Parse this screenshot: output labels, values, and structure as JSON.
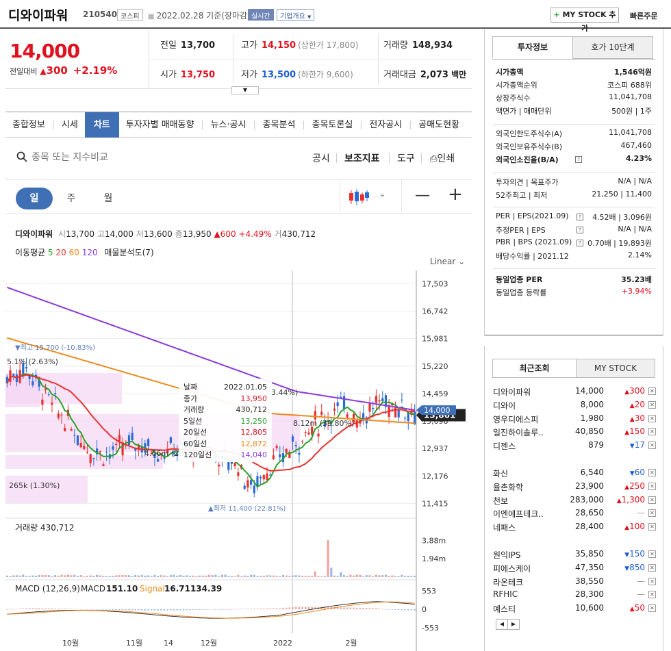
{
  "header": {
    "stock_name": "디와이파워",
    "stock_code": "210540",
    "market_badge": "코스피",
    "date_text": "2022.02.28 기준(장마감)",
    "realtime_badge": "실시간",
    "overview_btn": "기업개요",
    "mystock_btn": "MY STOCK 추가",
    "quick_order": "빠른주문"
  },
  "price": {
    "current": "14,000",
    "change_label": "전일대비",
    "change": "300",
    "change_pct": "+2.19%",
    "prev_label": "전일",
    "prev": "13,700",
    "high_label": "고가",
    "high": "14,150",
    "upper_limit": "(상한가 17,800)",
    "volume_label": "거래량",
    "volume": "148,934",
    "open_label": "시가",
    "open": "13,750",
    "low_label": "저가",
    "low": "13,500",
    "lower_limit": "(하한가 9,600)",
    "value_label": "거래대금",
    "value": "2,073",
    "value_unit": "백만"
  },
  "tabs": [
    "종합정보",
    "시세",
    "차트",
    "투자자별 매매동향",
    "뉴스·공시",
    "종목분석",
    "종목토론실",
    "전자공시",
    "공매도현황"
  ],
  "active_tab": 2,
  "search": {
    "placeholder": "종목 또는 지수비교"
  },
  "tools": {
    "disclosure": "공시",
    "indicator": "보조지표",
    "tools": "도구",
    "print": "인쇄"
  },
  "periods": [
    "일",
    "주",
    "월"
  ],
  "active_period": 0,
  "ohlc": {
    "name": "디와이파워",
    "open_label": "시",
    "open": "13,700",
    "high_label": "고",
    "high": "14,000",
    "low_label": "저",
    "low": "13,600",
    "close_label": "종",
    "close": "13,950",
    "change": "▲600",
    "change_pct": "+4.49%",
    "vol_label": "거",
    "vol": "430,712"
  },
  "ma_legend": {
    "label": "이동평균",
    "p5": "5",
    "p20": "20",
    "p60": "60",
    "p120": "120",
    "analysis": "매물분석도(7)"
  },
  "scale": "Linear",
  "chart_data": {
    "type": "line",
    "price_axis": [
      "17,503",
      "16,742",
      "15,981",
      "15,220",
      "14,459",
      "13,698",
      "12,937",
      "12,176",
      "11,415"
    ],
    "price_ylim": [
      11046,
      17870
    ],
    "x_labels": [
      "10월",
      "11월",
      "14",
      "12월",
      "2022",
      "2월"
    ],
    "current_price_tag": "13,861",
    "current_tag_partial": "14,000",
    "high_marker": "▼최고 15,700 (-10.83%)",
    "low_marker": "▲최저 11,400 (22.81%)",
    "profile_labels": [
      "5.1% (2.63%)",
      "3.44%)",
      "8.12m (39.80%)",
      "4.66m (22",
      "265k (1.30%)"
    ],
    "volume_title": "거래량 430,712",
    "volume_axis": [
      "3.88m",
      "1.94m"
    ],
    "macd_title": "MACD (12,26,9)",
    "macd_label": "MACD",
    "macd_value": "151.10",
    "signal_label": "Signal",
    "signal_value": "16.71134.39",
    "macd_axis": [
      "553",
      "0",
      "-553"
    ],
    "tooltip": {
      "date_label": "날짜",
      "date": "2022.01.05",
      "close_label": "종가",
      "close": "13,950",
      "vol_label": "거래량",
      "vol": "430,712",
      "ma5_label": "5일선",
      "ma5": "13,250",
      "ma20_label": "20일선",
      "ma20": "12,805",
      "ma60_label": "60일선",
      "ma60": "12,872",
      "ma120_label": "120일선",
      "ma120": "14,040"
    },
    "colors": {
      "ma5": "#2aa02a",
      "ma20": "#e8302f",
      "ma60": "#f08a1c",
      "ma120": "#8a3bdc",
      "up": "#e8302f",
      "down": "#2a6bd6"
    }
  },
  "info_panel": {
    "tab_invest": "투자정보",
    "tab_hoga": "호가 10단계",
    "rows1": [
      {
        "l": "시가총액",
        "r": "1,546억원",
        "bold": true
      },
      {
        "l": "시가총액순위",
        "r": "코스피 688위"
      },
      {
        "l": "상장주식수",
        "r": "11,041,708"
      },
      {
        "l": "액면가 | 매매단위",
        "r": "500원 | 1주"
      }
    ],
    "rows2": [
      {
        "l": "외국인한도주식수(A)",
        "r": "11,041,708"
      },
      {
        "l": "외국인보유주식수(B)",
        "r": "467,460"
      },
      {
        "l": "외국인소진율(B/A)",
        "r": "4.23%",
        "bold": true
      }
    ],
    "rows3": [
      {
        "l": "투자의견 | 목표주가",
        "r": "N/A | N/A"
      },
      {
        "l": "52주최고 | 최저",
        "r": "21,250 | 11,400"
      }
    ],
    "rows4": [
      {
        "l": "PER | EPS(2021.09)",
        "m": "4.52배 | 3,096원"
      },
      {
        "l": "추정PER | EPS",
        "m": "N/A | N/A"
      },
      {
        "l": "PBR | BPS (2021.09)",
        "m": "0.70배 | 19,893원"
      },
      {
        "l": "배당수익률 | 2021.12",
        "m": "2.14%"
      }
    ],
    "rows5": [
      {
        "l": "동일업종 PER",
        "r": "35.23배",
        "bold": true
      },
      {
        "l": "동일업종 등락률",
        "r": "+3.94%",
        "red": true
      }
    ]
  },
  "recent_panel": {
    "tab_recent": "최근조회",
    "tab_mystock": "MY STOCK",
    "items": [
      {
        "n": "디와이파워",
        "p": "14,000",
        "c": "300",
        "up": true
      },
      {
        "n": "디와이",
        "p": "8,000",
        "c": "20",
        "up": true
      },
      {
        "n": "영우디에스피",
        "p": "1,980",
        "c": "30",
        "up": true
      },
      {
        "n": "일진하이솔루..",
        "p": "40,850",
        "c": "150",
        "up": true
      },
      {
        "n": "디젠스",
        "p": "879",
        "c": "17",
        "up": false
      },
      {
        "n": "화신",
        "p": "6,540",
        "c": "60",
        "up": false
      },
      {
        "n": "율촌화학",
        "p": "23,900",
        "c": "250",
        "up": true
      },
      {
        "n": "천보",
        "p": "283,000",
        "c": "1,300",
        "up": true
      },
      {
        "n": "이엔에프테크..",
        "p": "28,650",
        "c": "",
        "flat": true
      },
      {
        "n": "네패스",
        "p": "28,400",
        "c": "100",
        "up": true
      },
      {
        "n": "원익IPS",
        "p": "35,850",
        "c": "150",
        "up": false
      },
      {
        "n": "피에스케이",
        "p": "47,350",
        "c": "850",
        "up": false
      },
      {
        "n": "라온테크",
        "p": "38,550",
        "c": "",
        "flat": true
      },
      {
        "n": "RFHIC",
        "p": "28,300",
        "c": "",
        "flat": true
      },
      {
        "n": "예스티",
        "p": "10,600",
        "c": "50",
        "up": true
      }
    ]
  }
}
